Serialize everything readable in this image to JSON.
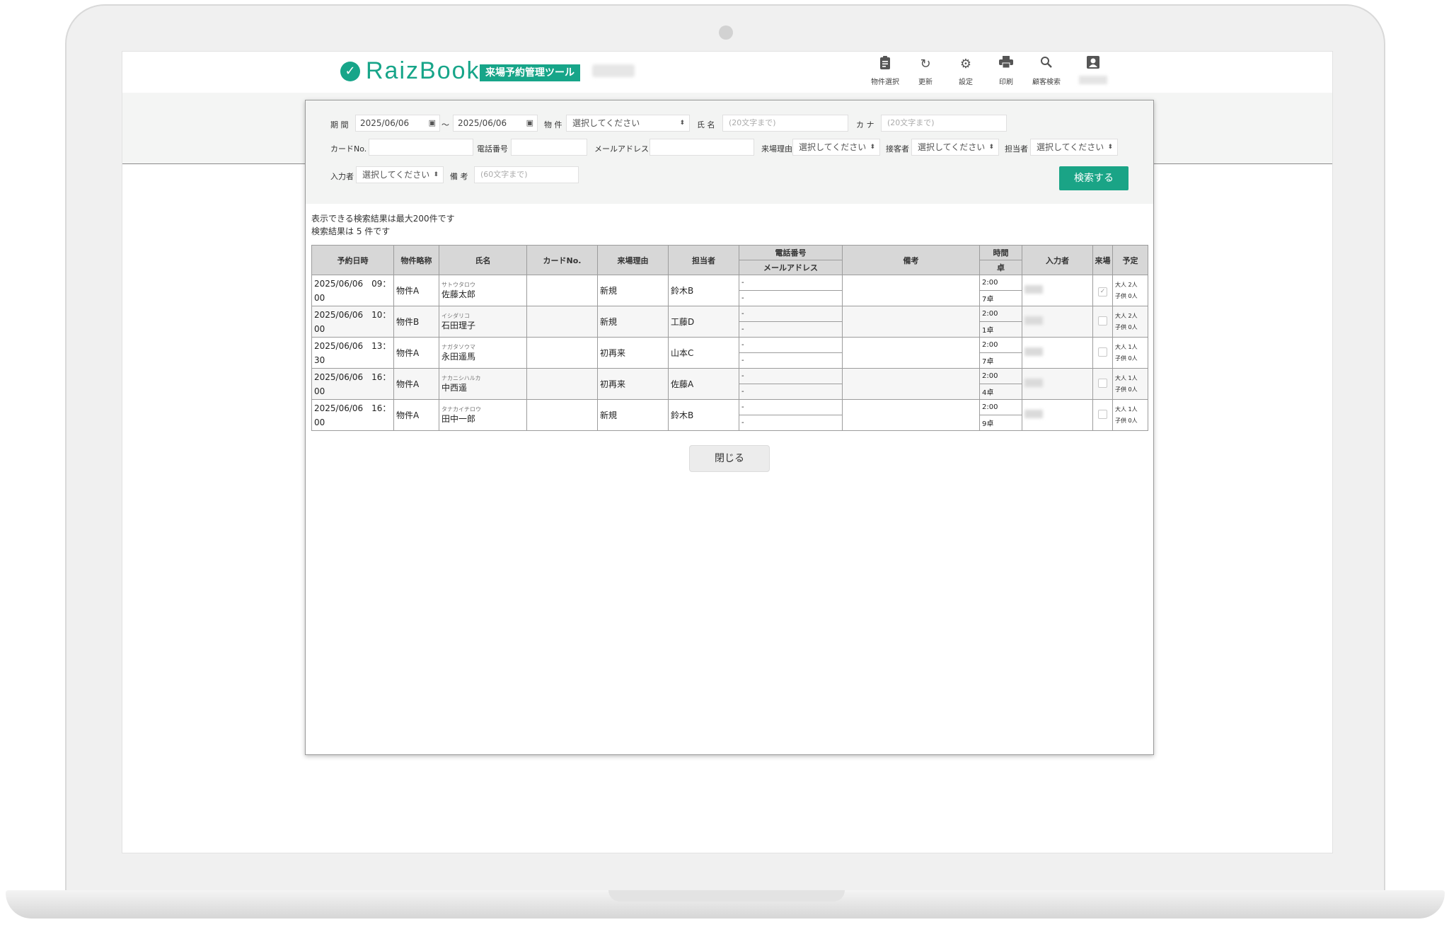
{
  "header": {
    "logo_text": "RaizBook",
    "logo_badge": "来場予約管理ツール",
    "buttons": [
      {
        "label": "物件選択",
        "icon": "clipboard-icon"
      },
      {
        "label": "更新",
        "icon": "refresh-icon"
      },
      {
        "label": "設定",
        "icon": "gear-icon"
      },
      {
        "label": "印刷",
        "icon": "printer-icon"
      },
      {
        "label": "顧客検索",
        "icon": "search-icon"
      },
      {
        "label": "",
        "icon": "user-icon"
      }
    ]
  },
  "filters": {
    "period_label": "期 間",
    "date_from": "2025/06/06",
    "tilde": "～",
    "date_to": "2025/06/06",
    "property_label": "物 件",
    "property_value": "選択してください",
    "name_label": "氏 名",
    "name_placeholder": "(20文字まで)",
    "kana_label": "カ ナ",
    "kana_placeholder": "(20文字まで)",
    "card_label": "カードNo.",
    "phone_label": "電話番号",
    "email_label": "メールアドレス",
    "reason_label": "来場理由",
    "reason_value": "選択してください",
    "guest_label": "接客者",
    "guest_value": "選択してください",
    "staff_label": "担当者",
    "staff_value": "選択してください",
    "entered_label": "入力者",
    "entered_value": "選択してください",
    "notes_label": "備 考",
    "notes_placeholder": "(60文字まで)",
    "search_button": "検索する"
  },
  "notes": {
    "max_results": "表示できる検索結果は最大200件です",
    "result_count": "検索結果は 5 件です"
  },
  "table": {
    "headers": {
      "datetime": "予約日時",
      "property": "物件略称",
      "name": "氏名",
      "card": "カードNo.",
      "reason": "来場理由",
      "staff": "担当者",
      "phone": "電話番号",
      "email": "メールアドレス",
      "notes": "備考",
      "time": "時間",
      "table": "卓",
      "entered_by": "入力者",
      "visited": "来場",
      "schedule": "予定"
    },
    "rows": [
      {
        "date": "2025/06/06　09：",
        "date2": "00",
        "property": "物件A",
        "kana": "サトウタロウ",
        "name": "佐藤太郎",
        "reason": "新規",
        "staff": "鈴木B",
        "phone": "-",
        "email": "-",
        "time": "2:00",
        "table": "7卓",
        "visited": true,
        "adults": "大人 2人",
        "children": "子供 0人"
      },
      {
        "date": "2025/06/06　10：",
        "date2": "00",
        "property": "物件B",
        "kana": "イシダリコ",
        "name": "石田理子",
        "reason": "新規",
        "staff": "工藤D",
        "phone": "-",
        "email": "-",
        "time": "2:00",
        "table": "1卓",
        "visited": false,
        "adults": "大人 2人",
        "children": "子供 0人"
      },
      {
        "date": "2025/06/06　13：",
        "date2": "30",
        "property": "物件A",
        "kana": "ナガタソウマ",
        "name": "永田遥馬",
        "reason": "初再来",
        "staff": "山本C",
        "phone": "-",
        "email": "-",
        "time": "2:00",
        "table": "7卓",
        "visited": false,
        "adults": "大人 1人",
        "children": "子供 0人"
      },
      {
        "date": "2025/06/06　16：",
        "date2": "00",
        "property": "物件A",
        "kana": "ナカニシハルカ",
        "name": "中西遥",
        "reason": "初再来",
        "staff": "佐藤A",
        "phone": "-",
        "email": "-",
        "time": "2:00",
        "table": "4卓",
        "visited": false,
        "adults": "大人 1人",
        "children": "子供 0人"
      },
      {
        "date": "2025/06/06　16：",
        "date2": "00",
        "property": "物件A",
        "kana": "タナカイチロウ",
        "name": "田中一郎",
        "reason": "新規",
        "staff": "鈴木B",
        "phone": "-",
        "email": "-",
        "time": "2:00",
        "table": "9卓",
        "visited": false,
        "adults": "大人 1人",
        "children": "子供 0人"
      }
    ]
  },
  "close_button": "閉じる",
  "colors": {
    "brand": "#17a589",
    "search_button": "#1aa486",
    "header_cell": "#d7d7d7"
  }
}
